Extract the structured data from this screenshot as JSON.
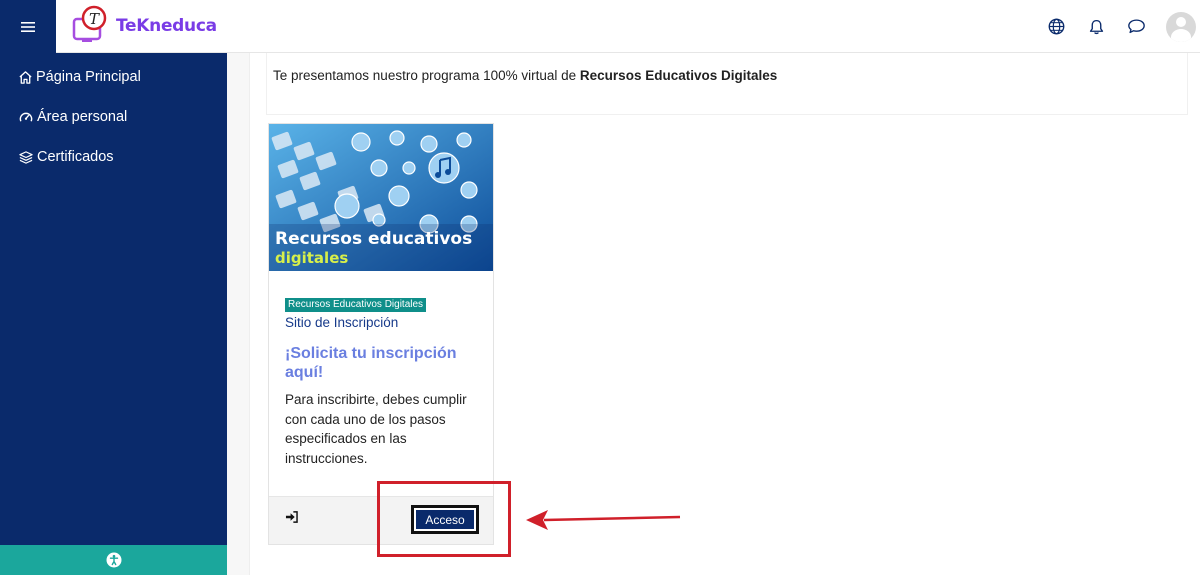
{
  "brand": {
    "name": "TeKneduca"
  },
  "topbar": {
    "menu_icon": "hamburger-icon",
    "icons": [
      "globe-icon",
      "bell-icon",
      "chat-icon",
      "avatar-icon"
    ]
  },
  "sidebar": {
    "items": [
      {
        "label": "Página Principal",
        "icon": "home-icon"
      },
      {
        "label": "Área personal",
        "icon": "dashboard-icon"
      },
      {
        "label": "Certificados",
        "icon": "layers-icon"
      }
    ],
    "accessibility_icon": "accessibility-icon",
    "accent_color": "#1ba79c"
  },
  "main": {
    "intro_prefix": "Te presentamos nuestro programa 100% virtual de ",
    "intro_bold": "Recursos Educativos Digitales"
  },
  "card": {
    "image_title_line1": "Recursos educativos",
    "image_title_line2": "digitales",
    "category": "Recursos Educativos Digitales",
    "subtitle": "Sitio de Inscripción",
    "title": "¡Solicita tu inscripción aquí!",
    "description": "Para inscribirte, debes cumplir con cada uno de los pasos especificados en las instrucciones.",
    "enter_icon": "sign-in-icon",
    "button_label": "Acceso"
  },
  "colors": {
    "sidebar_bg": "#0a2a6b",
    "highlight": "#d0202a",
    "title_color": "#6a7fe0"
  }
}
